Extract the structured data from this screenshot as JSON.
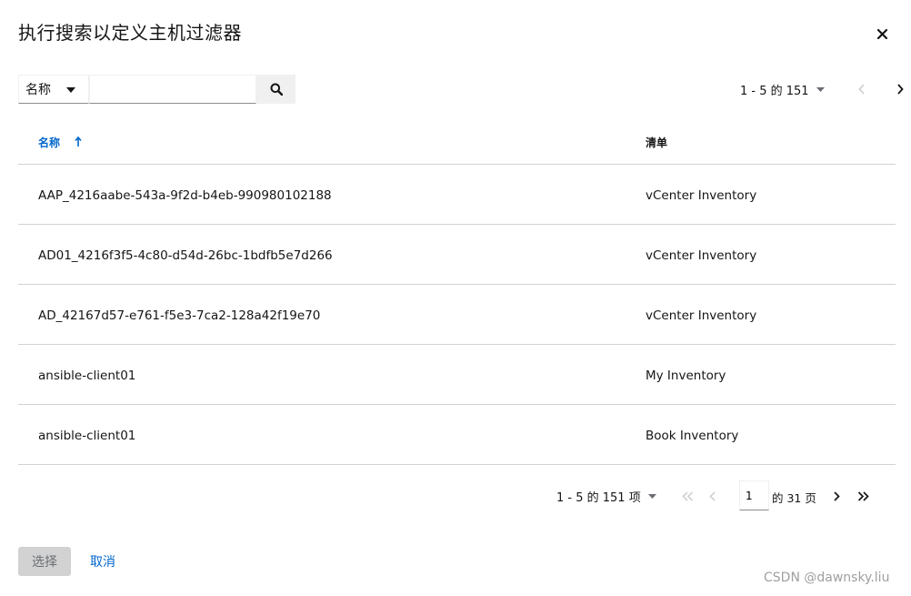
{
  "modal": {
    "title": "执行搜索以定义主机过滤器",
    "close_icon": "close-icon"
  },
  "toolbar": {
    "filter_attribute": "名称",
    "search_value": "",
    "search_placeholder": "",
    "search_icon": "search-icon"
  },
  "top_pagination": {
    "range_label": "1 - 5 的 151",
    "prev_icon": "chevron-left-icon",
    "next_icon": "chevron-right-icon"
  },
  "table": {
    "columns": [
      "名称",
      "清单"
    ],
    "sort_icon": "arrow-up-icon",
    "rows": [
      {
        "name": "AAP_4216aabe-543a-9f2d-b4eb-990980102188",
        "inventory": "vCenter Inventory"
      },
      {
        "name": "AD01_4216f3f5-4c80-d54d-26bc-1bdfb5e7d266",
        "inventory": "vCenter Inventory"
      },
      {
        "name": "AD_42167d57-e761-f5e3-7ca2-128a42f19e70",
        "inventory": "vCenter Inventory"
      },
      {
        "name": "ansible-client01",
        "inventory": "My Inventory"
      },
      {
        "name": "ansible-client01",
        "inventory": "Book Inventory"
      }
    ]
  },
  "bottom_pagination": {
    "range_label": "1 - 5 的 151 项",
    "current_page": "1",
    "of_pages_label": "的 31 页"
  },
  "footer": {
    "select_label": "选择",
    "cancel_label": "取消"
  },
  "watermark": "CSDN @dawnsky.liu",
  "colors": {
    "link": "#0066cc",
    "text": "#151515",
    "border": "#d2d2d2",
    "disabled_bg": "#d2d2d2",
    "disabled_text": "#6a6e73",
    "icon_disabled": "#b8bbbe"
  }
}
